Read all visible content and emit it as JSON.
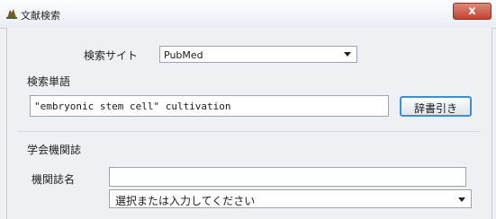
{
  "window": {
    "title": "文献検索",
    "close_label": "x"
  },
  "search_site": {
    "label": "検索サイト",
    "value": "PubMed"
  },
  "search_term": {
    "label": "検索単語",
    "value": "\"embryonic stem cell\" cultivation",
    "dictionary_button": "辞書引き"
  },
  "journal": {
    "section_label": "学会機関誌",
    "name_label": "機関誌名",
    "name_value": "",
    "select_placeholder": "選択または入力してください"
  },
  "colors": {
    "close_button": "#c2432d",
    "button_focus_border": "#3f8ed0"
  }
}
